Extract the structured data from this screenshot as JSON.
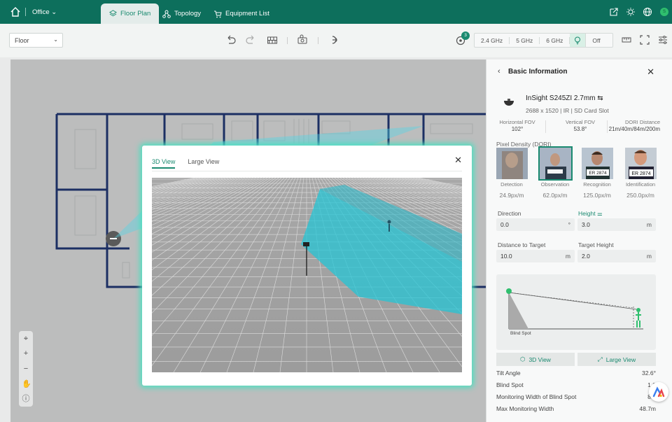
{
  "topbar": {
    "office": "Office",
    "tabs": [
      "Floor Plan",
      "Topology",
      "Equipment List"
    ],
    "avatar": "S"
  },
  "toolbar": {
    "floor_select": "Floor",
    "notification_count": "3",
    "bands": [
      "2.4 GHz",
      "5 GHz",
      "6 GHz"
    ],
    "heatmap_state": "Off"
  },
  "modal": {
    "tabs": [
      "3D View",
      "Large View"
    ],
    "active_tab": "3D View"
  },
  "panel": {
    "title": "Basic Information",
    "model": "InSight S245ZI  2.7mm",
    "specs": "2688 x 1520 | IR | SD Card Slot",
    "fov": [
      {
        "label": "Horizontal FOV",
        "value": "102°"
      },
      {
        "label": "Vertical FOV",
        "value": "53.8°"
      },
      {
        "label": "DORI Distance",
        "value": "21m/40m/84m/200m"
      }
    ],
    "pixel_density_label": "Pixel Density (DORI)",
    "dori": [
      {
        "label": "Detection",
        "value": "24.9px/m",
        "plate": ""
      },
      {
        "label": "Observation",
        "value": "62.0px/m",
        "plate": ""
      },
      {
        "label": "Recognition",
        "value": "125.0px/m",
        "plate": "ER 2874"
      },
      {
        "label": "Identification",
        "value": "250.0px/m",
        "plate": "ER 2874"
      }
    ],
    "direction_label": "Direction",
    "direction_value": "0.0",
    "direction_unit": "°",
    "height_label": "Height",
    "height_value": "3.0",
    "height_unit": "m",
    "distance_label": "Distance to Target",
    "distance_value": "10.0",
    "distance_unit": "m",
    "target_height_label": "Target Height",
    "target_height_value": "2.0",
    "target_height_unit": "m",
    "blind_spot_label": "Blind Spot",
    "btn_3d": "3D View",
    "btn_large": "Large View",
    "stats": [
      {
        "label": "Tilt Angle",
        "value": "32.6°"
      },
      {
        "label": "Blind Spot",
        "value": "1.8"
      },
      {
        "label": "Monitoring Width of Blind Spot",
        "value": "8.6"
      },
      {
        "label": "Max Monitoring Width",
        "value": "48.7m"
      }
    ]
  }
}
